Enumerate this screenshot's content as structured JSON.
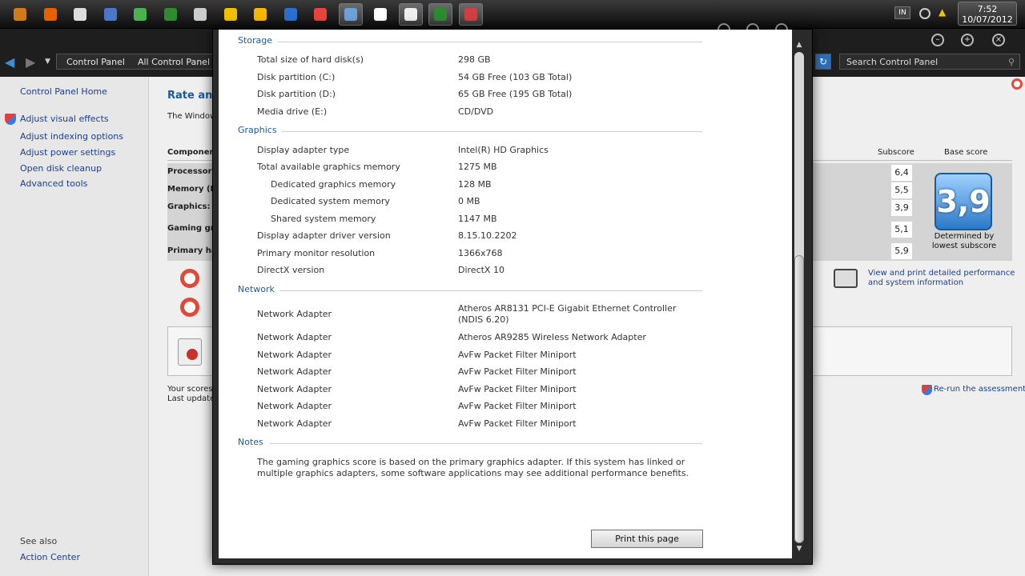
{
  "taskbar": {
    "icons": [
      {
        "name": "gimp-icon",
        "color": "#d07a1c",
        "active": false
      },
      {
        "name": "firefox-icon",
        "color": "#e66000",
        "active": false
      },
      {
        "name": "blackberry-icon",
        "color": "#dddddd",
        "active": false
      },
      {
        "name": "docs-icon",
        "color": "#4a78c8",
        "active": false
      },
      {
        "name": "cloud-icon",
        "color": "#4caf50",
        "active": false
      },
      {
        "name": "terminal-icon",
        "color": "#2e8b2e",
        "active": false
      },
      {
        "name": "inkscape-icon",
        "color": "#cccccc",
        "active": false
      },
      {
        "name": "mail-icon",
        "color": "#f2c200",
        "active": false
      },
      {
        "name": "smiley-icon",
        "color": "#f5b700",
        "active": false
      },
      {
        "name": "photoshop-icon",
        "color": "#2a6fd1",
        "active": false
      },
      {
        "name": "chrome-icon",
        "color": "#e8453c",
        "active": false
      },
      {
        "name": "explorer-icon",
        "color": "#6fa0d8",
        "active": true
      },
      {
        "name": "clock-app-icon",
        "color": "#ffffff",
        "active": false
      },
      {
        "name": "pattern-icon",
        "color": "#eeeeee",
        "active": true
      },
      {
        "name": "monitor-icon",
        "color": "#2e8b2e",
        "active": true
      },
      {
        "name": "disk-icon",
        "color": "#d04040",
        "active": true
      }
    ],
    "tray": {
      "lang": "IN"
    },
    "clock": {
      "time": "7:52",
      "date": "10/07/2012"
    }
  },
  "explorer": {
    "address": [
      "Control Panel",
      "All Control Panel Ite"
    ],
    "search_placeholder": "Search Control Panel",
    "sidebar": {
      "home": "Control Panel Home",
      "links": [
        "Adjust visual effects",
        "Adjust indexing options",
        "Adjust power settings",
        "Open disk cleanup",
        "Advanced tools"
      ],
      "see_also": "See also",
      "action_center": "Action Center"
    },
    "main": {
      "title": "Rate and",
      "desc": "The Windows",
      "col_component": "Componen",
      "col_subscore": "Subscore",
      "col_basescore": "Base score",
      "components": [
        "Processor:",
        "Memory (R",
        "Graphics:",
        "Gaming gr",
        "Primary ha"
      ],
      "subscores": [
        "6,4",
        "5,5",
        "3,9",
        "5,1",
        "5,9"
      ],
      "base_score": "3,9",
      "base_caption": "Determined by lowest subscore",
      "view_print": "View and print detailed performance and system information",
      "scores_line1": "Your scores a",
      "scores_line2": "Last update:",
      "rerun": "Re-run the assessment"
    }
  },
  "dialog": {
    "sections": {
      "storage": "Storage",
      "graphics": "Graphics",
      "network": "Network",
      "notes": "Notes"
    },
    "storage": [
      {
        "label": "Total size of hard disk(s)",
        "value": "298 GB"
      },
      {
        "label": "Disk partition (C:)",
        "value": "54 GB Free (103 GB Total)"
      },
      {
        "label": "Disk partition (D:)",
        "value": "65 GB Free (195 GB Total)"
      },
      {
        "label": "Media drive (E:)",
        "value": "CD/DVD"
      }
    ],
    "graphics": [
      {
        "label": "Display adapter type",
        "value": "Intel(R) HD Graphics"
      },
      {
        "label": "Total available graphics memory",
        "value": "1275 MB"
      },
      {
        "label": "Dedicated graphics memory",
        "value": "128 MB"
      },
      {
        "label": "Dedicated system memory",
        "value": "0 MB"
      },
      {
        "label": "Shared system memory",
        "value": "1147 MB"
      },
      {
        "label": "Display adapter driver version",
        "value": "8.15.10.2202"
      },
      {
        "label": "Primary monitor resolution",
        "value": "1366x768"
      },
      {
        "label": "DirectX version",
        "value": "DirectX 10"
      }
    ],
    "network": [
      {
        "label": "Network Adapter",
        "value": "Atheros AR8131 PCI-E Gigabit Ethernet Controller (NDIS 6.20)"
      },
      {
        "label": "Network Adapter",
        "value": "Atheros AR9285 Wireless Network Adapter"
      },
      {
        "label": "Network Adapter",
        "value": "AvFw Packet Filter Miniport"
      },
      {
        "label": "Network Adapter",
        "value": "AvFw Packet Filter Miniport"
      },
      {
        "label": "Network Adapter",
        "value": "AvFw Packet Filter Miniport"
      },
      {
        "label": "Network Adapter",
        "value": "AvFw Packet Filter Miniport"
      },
      {
        "label": "Network Adapter",
        "value": "AvFw Packet Filter Miniport"
      }
    ],
    "notes": "The gaming graphics score is based on the primary graphics adapter. If this system has linked or multiple graphics adapters, some software applications may see additional performance benefits.",
    "print_button": "Print this page"
  }
}
